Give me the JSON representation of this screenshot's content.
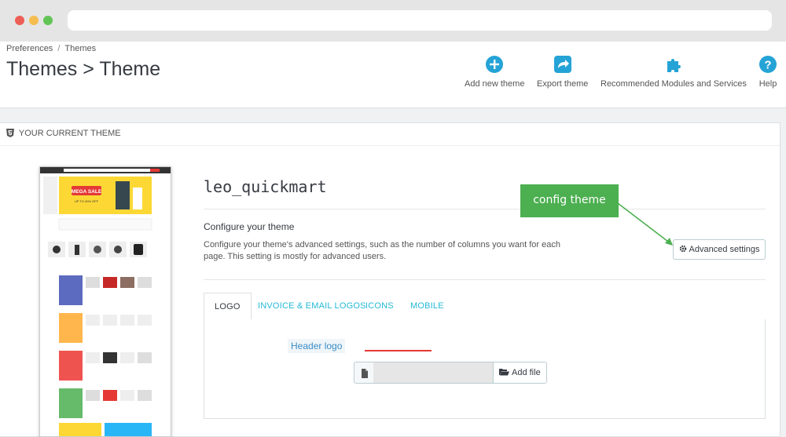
{
  "breadcrumb": {
    "parent": "Preferences",
    "separator": "/",
    "current": "Themes"
  },
  "page_title": "Themes > Theme",
  "toolbar": [
    {
      "label": "Add new theme",
      "icon": "plus-circle-icon"
    },
    {
      "label": "Export theme",
      "icon": "export-share-icon"
    },
    {
      "label": "Recommended Modules and Services",
      "icon": "puzzle-piece-icon"
    },
    {
      "label": "Help",
      "icon": "question-circle-icon"
    }
  ],
  "panel": {
    "heading": "YOUR CURRENT THEME",
    "theme_name": "leo_quickmart",
    "configure_title": "Configure your theme",
    "configure_desc": "Configure your theme's advanced settings, such as the number of columns you want for each page. This setting is mostly for advanced users.",
    "advanced_button": "Advanced settings",
    "preview_banner": {
      "title": "MEGA SALE",
      "subtitle": "UP TO 40% OFF"
    }
  },
  "annotation": {
    "callout": "config theme"
  },
  "tabs": [
    {
      "label": "LOGO",
      "active": true
    },
    {
      "label": "INVOICE & EMAIL LOGOS",
      "active": false
    },
    {
      "label": "ICONS",
      "active": false
    },
    {
      "label": "MOBILE",
      "active": false
    }
  ],
  "logo_tab": {
    "field_label": "Header logo",
    "file_value": "",
    "add_file": "Add file"
  },
  "colors": {
    "accent": "#25b9d7",
    "icon_blue": "#25a3d6",
    "callout_green": "#4caf50",
    "annotation_red": "#e53935"
  }
}
